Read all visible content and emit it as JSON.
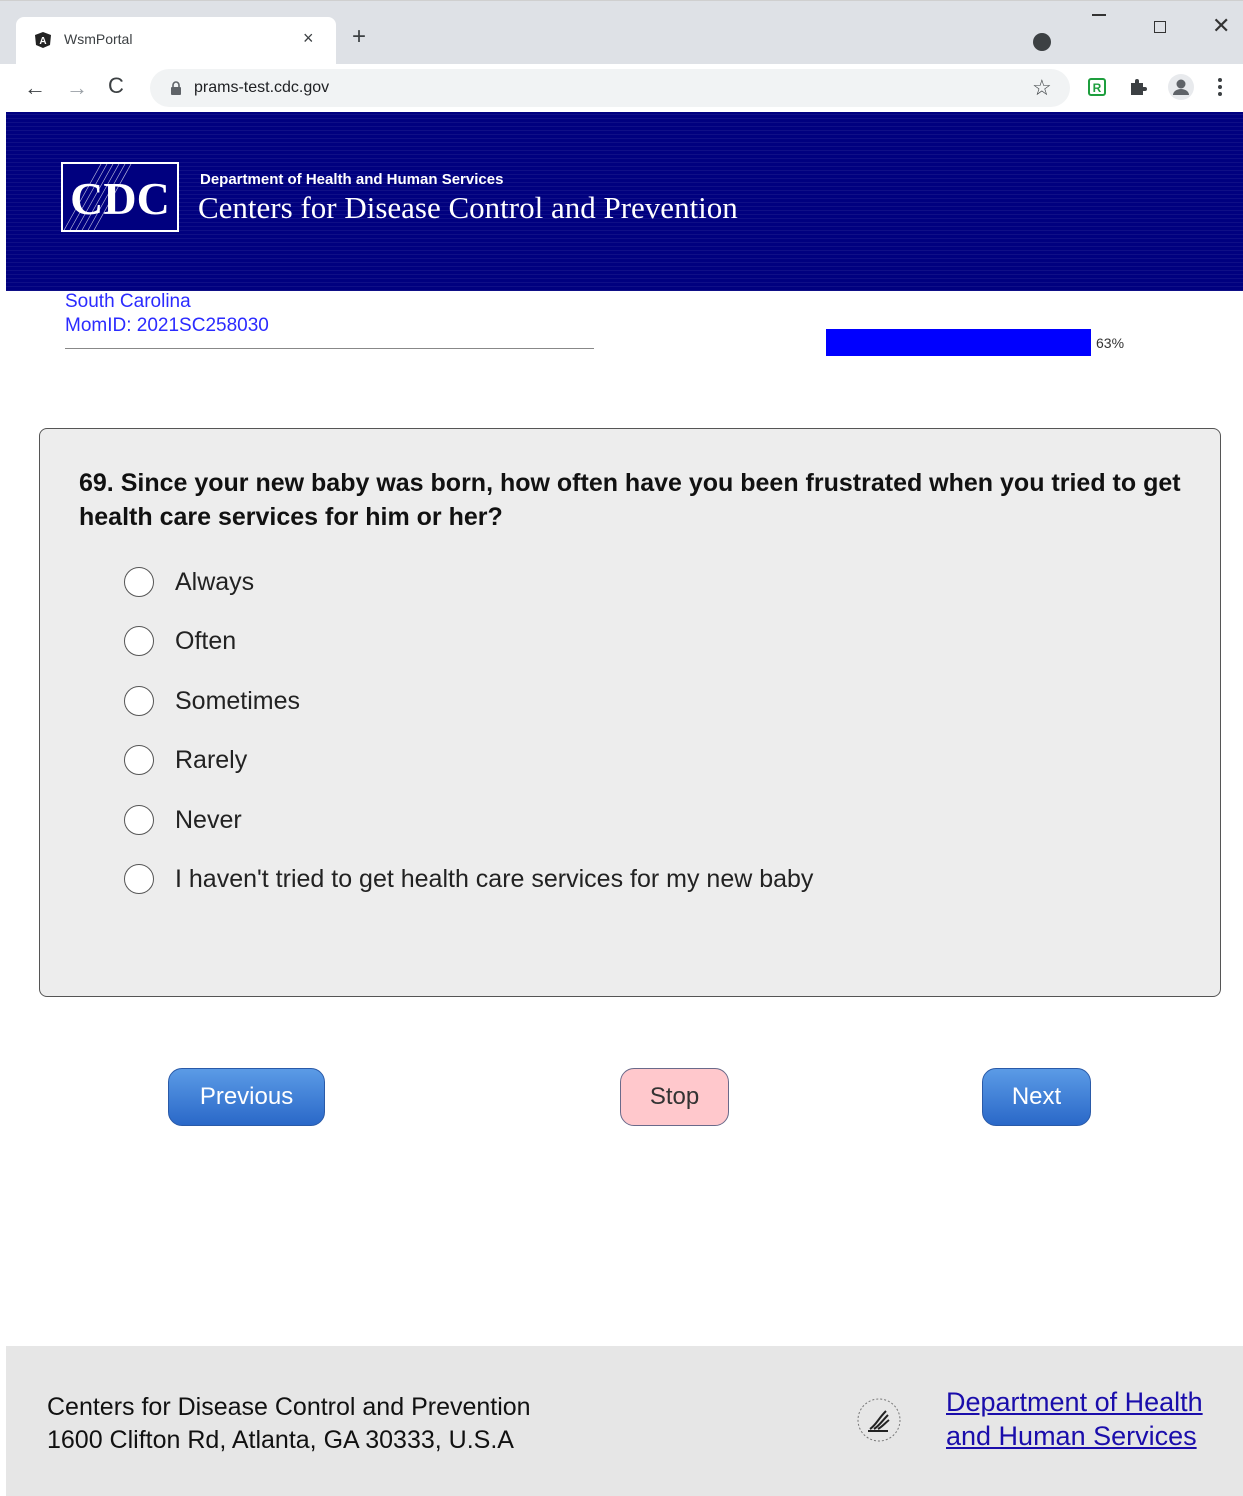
{
  "browser": {
    "tab_title": "WsmPortal",
    "tab_close": "×",
    "new_tab": "+",
    "url": "prams-test.cdc.gov",
    "back": "←",
    "forward": "→",
    "reload": "C",
    "star": "☆",
    "close_window": "✕"
  },
  "header": {
    "logo_text": "CDC",
    "department": "Department of Health and Human Services",
    "agency": "Centers for Disease Control and Prevention"
  },
  "respondent": {
    "state": "South Carolina",
    "mom_id": "MomID: 2021SC258030"
  },
  "progress": {
    "percent": 63,
    "label": "63%",
    "color": "#0000ff"
  },
  "question": {
    "text": "69. Since your new baby was born, how often have you been frustrated when you tried to get health care services for him or her?",
    "options": [
      "Always",
      "Often",
      "Sometimes",
      "Rarely",
      "Never",
      "I haven't tried to get health care services for my new baby"
    ]
  },
  "buttons": {
    "previous": "Previous",
    "stop": "Stop",
    "next": "Next"
  },
  "footer": {
    "org": "Centers for Disease Control and Prevention",
    "address": "1600 Clifton Rd, Atlanta, GA 30333, U.S.A",
    "hhs_link_line1": "Department of Health",
    "hhs_link_line2": "and Human Services"
  },
  "colors": {
    "header_bg": "#00007f",
    "link": "#1a0dab",
    "respondent_text": "#2b2bff",
    "primary_button": "#2a68c8",
    "stop_button": "#ffc8cc"
  },
  "icons": [
    "angular-favicon-icon",
    "lock-icon",
    "star-icon",
    "extension-icon",
    "puzzle-icon",
    "profile-icon",
    "kebab-menu-icon",
    "hhs-eagle-icon"
  ]
}
